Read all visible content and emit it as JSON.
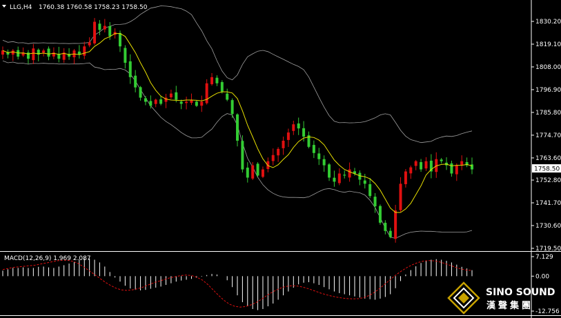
{
  "header": {
    "symbol": "LLG,H4",
    "ohlc": "1760.38 1760.58 1758.23 1758.50"
  },
  "price_axis": {
    "ticks": [
      "1830.20",
      "1819.10",
      "1808.00",
      "1796.90",
      "1785.80",
      "1774.70",
      "1763.60",
      "1752.80",
      "1741.70",
      "1730.60",
      "1719.50"
    ],
    "current": "1758.50"
  },
  "macd": {
    "label": "MACD(12,26,9) 1.969 2.087",
    "ticks": [
      "7.129",
      "0.00",
      "-12.756"
    ]
  },
  "logo": {
    "en": "SINO SOUND",
    "cn": "漢聲集團"
  },
  "colors": {
    "background": "#000000",
    "bull": "#e01010",
    "bear": "#33cc33",
    "ma": "#e8e000",
    "bands": "#a0a0a0",
    "macd_hist": "#ffffff",
    "macd_signal": "#e01010",
    "axis": "#ffffff"
  },
  "chart_data": {
    "type": "candlestick",
    "timeframe": "H4",
    "ylim": [
      1716,
      1836
    ],
    "macd_ylim": [
      -12.756,
      7.129
    ],
    "candles_close_path": [
      1816,
      1814,
      1816,
      1813,
      1815,
      1812,
      1817,
      1814,
      1816,
      1813,
      1815,
      1812,
      1815,
      1813,
      1816,
      1814,
      1818,
      1820,
      1830,
      1826,
      1828,
      1823,
      1825,
      1818,
      1810,
      1803,
      1798,
      1793,
      1791,
      1789,
      1792,
      1790,
      1793,
      1795,
      1792,
      1790,
      1791,
      1792,
      1789,
      1791,
      1800,
      1803,
      1800,
      1796,
      1792,
      1785,
      1772,
      1758,
      1754,
      1760,
      1755,
      1758,
      1762,
      1765,
      1768,
      1772,
      1776,
      1780,
      1778,
      1774,
      1769,
      1766,
      1763,
      1760,
      1754,
      1752,
      1756,
      1755,
      1758,
      1756,
      1753,
      1751,
      1745,
      1740,
      1732,
      1728,
      1725,
      1738,
      1751,
      1757,
      1759,
      1762,
      1758,
      1762,
      1757,
      1763,
      1762,
      1760,
      1756,
      1760,
      1762,
      1760,
      1758
    ],
    "macd_hist": [
      2,
      2.5,
      3,
      3,
      3.2,
      3,
      3,
      3.4,
      3.5,
      3.2,
      3,
      3.5,
      4,
      4.6,
      5.2,
      6,
      6.5,
      6.4,
      6,
      5,
      3.5,
      1.5,
      -0.5,
      -2,
      -3.5,
      -4.5,
      -5,
      -5.2,
      -5,
      -4.6,
      -4.2,
      -3.8,
      -3.2,
      -2.6,
      -2,
      -1.6,
      -1.3,
      -1,
      -0.6,
      -0.2,
      0.4,
      0.8,
      0.6,
      0,
      -1.5,
      -4,
      -7,
      -9.5,
      -11,
      -12,
      -12.4,
      -12,
      -11,
      -10,
      -8.6,
      -7,
      -5.6,
      -4.2,
      -3,
      -2.4,
      -2.2,
      -2.6,
      -3.2,
      -4,
      -4.8,
      -5.6,
      -6.2,
      -6.6,
      -7,
      -7.4,
      -7.8,
      -8.2,
      -8.4,
      -8.6,
      -8.2,
      -7.6,
      -6.6,
      -4.4,
      -1.8,
      0.6,
      2.2,
      3.6,
      4.8,
      5.6,
      6,
      6.2,
      6,
      5.6,
      5,
      4.2,
      3.4,
      2.8,
      2.2
    ],
    "macd_signal": [
      2.4,
      2.8,
      3.2,
      3.4,
      3.6,
      3.8,
      4,
      4.4,
      4.8,
      5.2,
      5.6,
      5.8,
      5.8,
      5.4,
      4.6,
      3.4,
      2,
      0.6,
      -0.8,
      -2.2,
      -3.4,
      -4.4,
      -5,
      -5.2,
      -5,
      -4.6,
      -4,
      -3.2,
      -2.4,
      -1.8,
      -1.2,
      -0.6,
      -0.2,
      0.2,
      0.4,
      0.2,
      -0.4,
      -1.4,
      -3,
      -5,
      -7,
      -8.8,
      -10.2,
      -11,
      -11.3,
      -11.1,
      -10.5,
      -9.6,
      -8.4,
      -7,
      -5.8,
      -4.8,
      -4,
      -3.6,
      -3.5,
      -3.7,
      -4.2,
      -4.8,
      -5.5,
      -6.2,
      -6.8,
      -7.3,
      -7.7,
      -8,
      -8.2,
      -8.3,
      -8.2,
      -7.8,
      -7,
      -5.8,
      -4.3,
      -2.7,
      -1,
      0.6,
      2,
      3.2,
      4.2,
      5,
      5.5,
      5.7,
      5.6,
      5.2,
      4.6,
      3.9,
      3.2,
      2.6,
      2.2,
      2.1
    ]
  }
}
